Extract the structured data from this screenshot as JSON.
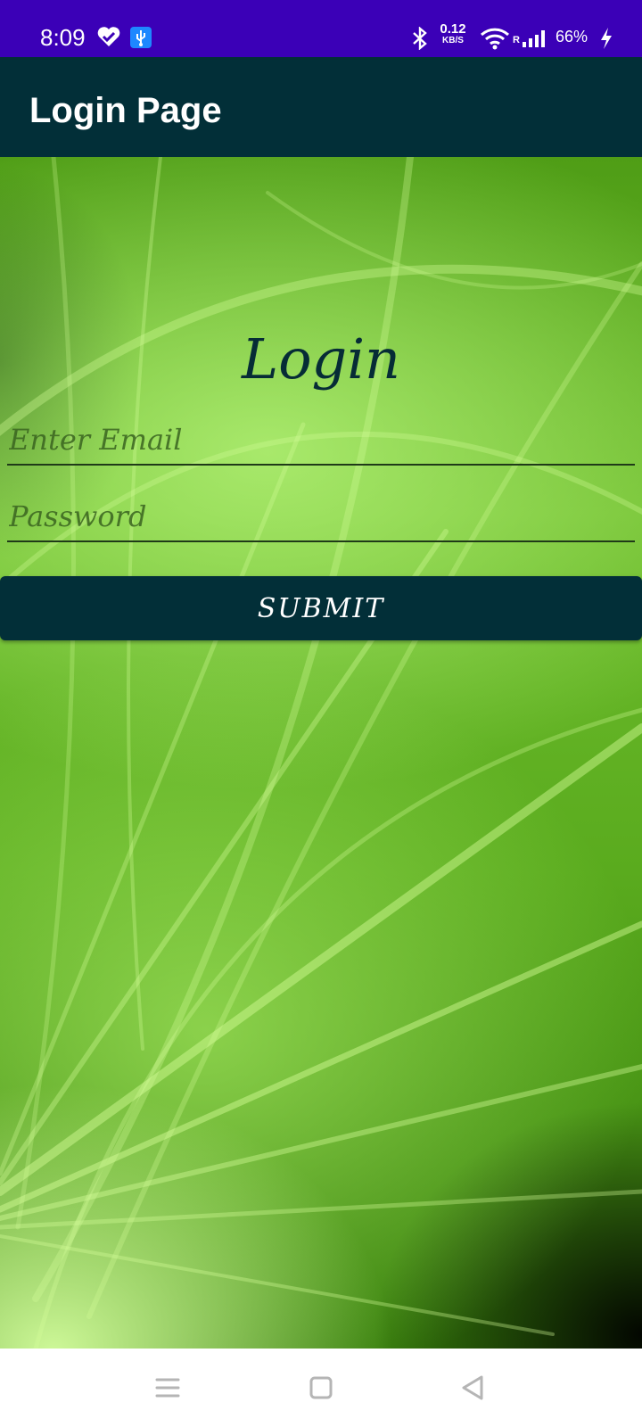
{
  "status_bar": {
    "time": "8:09",
    "left_icons": [
      "heart-check-icon",
      "usb-icon"
    ],
    "right_icons": [
      "bluetooth-icon",
      "wifi-icon",
      "signal-icon",
      "battery-charging-icon"
    ],
    "speed_value": "0.12",
    "speed_unit": "KB/S",
    "signal_label": "R",
    "battery": "66%",
    "background_color": "#3b00b7"
  },
  "app_bar": {
    "title": "Login Page",
    "background_color": "#022f38"
  },
  "login_form": {
    "heading": "Login",
    "email_placeholder": "Enter Email",
    "email_value": "",
    "password_placeholder": "Password",
    "password_value": "",
    "submit_label": "SUBMIT",
    "button_color": "#022f38"
  },
  "nav_bar": {
    "icons": [
      "menu-icon",
      "home-square-icon",
      "back-triangle-icon"
    ]
  }
}
